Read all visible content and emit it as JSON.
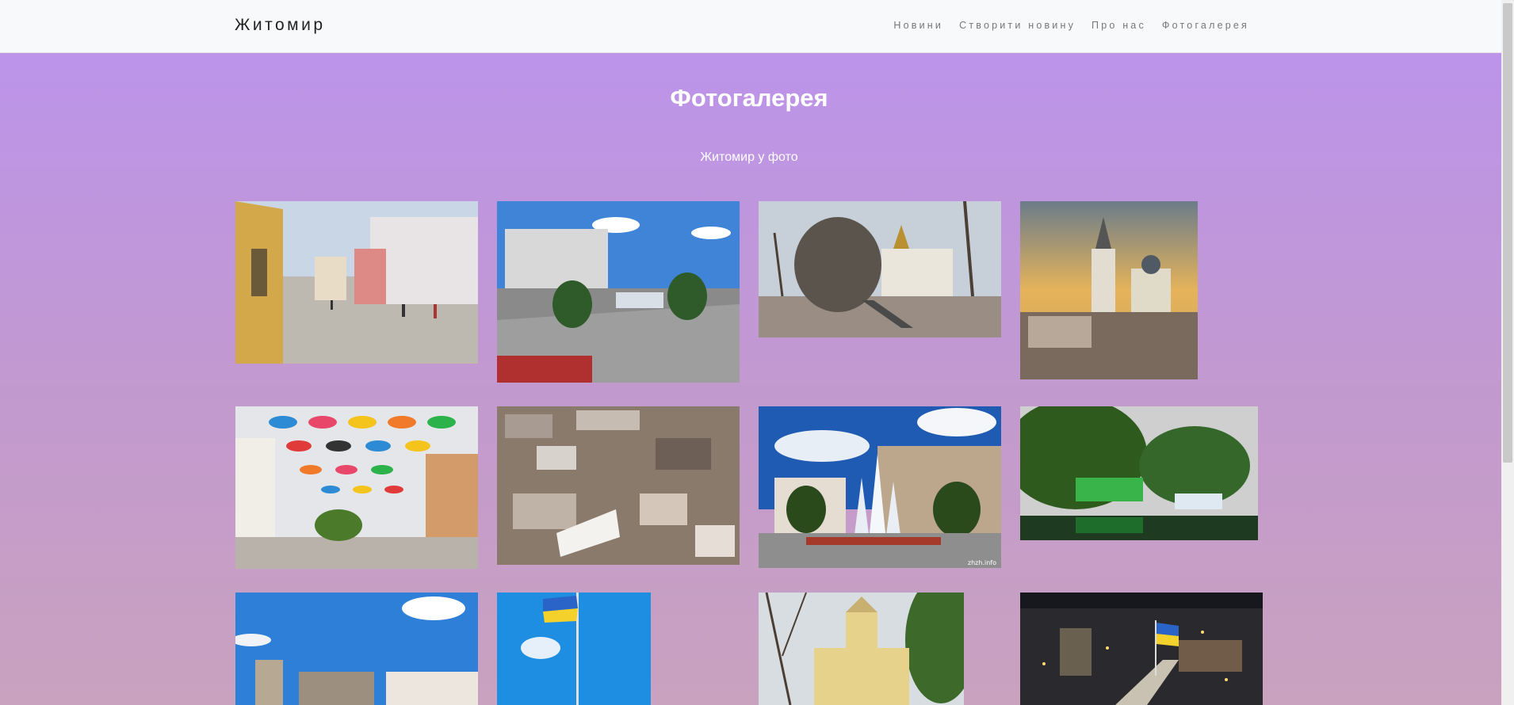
{
  "brand": "Житомир",
  "nav": [
    "Новини",
    "Створити новину",
    "Про нас",
    "Фотогалерея"
  ],
  "title": "Фотогалерея",
  "subtitle": "Житомир у фото",
  "photo_watermark": "zhzh.info"
}
